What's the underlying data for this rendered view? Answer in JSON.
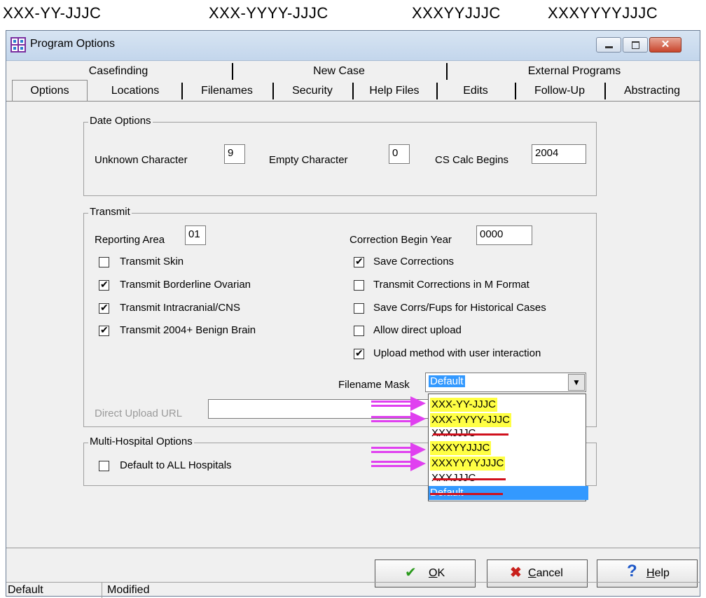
{
  "captions": [
    "XXX-YY-JJJC",
    "XXX-YYYY-JJJC",
    "XXXYYJJJC",
    "XXXYYYYJJJC"
  ],
  "window": {
    "title": "Program Options",
    "controls": [
      "minimize-icon",
      "maximize-icon",
      "close-icon"
    ]
  },
  "tabs": {
    "row1": [
      "Casefinding",
      "New Case",
      "External Programs"
    ],
    "row2": [
      "Options",
      "Locations",
      "Filenames",
      "Security",
      "Help Files",
      "Edits",
      "Follow-Up",
      "Abstracting"
    ],
    "active": "Options"
  },
  "date_options": {
    "title": "Date Options",
    "unknown_label": "Unknown Character",
    "unknown_value": "9",
    "empty_label": "Empty Character",
    "empty_value": "0",
    "cs_label": "CS Calc Begins",
    "cs_value": "2004"
  },
  "transmit": {
    "title": "Transmit",
    "reporting_label": "Reporting Area",
    "reporting_value": "01",
    "correction_label": "Correction Begin Year",
    "correction_value": "0000",
    "left_checks": [
      {
        "label": "Transmit Skin",
        "checked": false
      },
      {
        "label": "Transmit Borderline Ovarian",
        "checked": true
      },
      {
        "label": "Transmit Intracranial/CNS",
        "checked": true
      },
      {
        "label": "Transmit 2004+ Benign Brain",
        "checked": true
      }
    ],
    "right_checks": [
      {
        "label": "Save Corrections",
        "checked": true
      },
      {
        "label": "Transmit Corrections in M Format",
        "checked": false
      },
      {
        "label": "Save Corrs/Fups for Historical Cases",
        "checked": false
      },
      {
        "label": "Allow direct upload",
        "checked": false
      },
      {
        "label": "Upload method with user interaction",
        "checked": true
      }
    ],
    "filename_mask_label": "Filename Mask",
    "filename_mask_value": "Default",
    "direct_upload_label": "Direct Upload URL",
    "direct_upload_value": ""
  },
  "dropdown": {
    "options": [
      "XXX-YY-JJJC",
      "XXX-YYYY-JJJC",
      "XXXJJJC",
      "XXXYYJJJC",
      "XXXYYYYJJJC",
      "XXXJJJC",
      "Default"
    ],
    "highlighted": [
      0,
      1,
      3,
      4
    ],
    "struck": [
      2,
      5,
      6
    ],
    "selected": 6,
    "highlight_color": "#ffff44",
    "strike_color": "#d0101c",
    "arrow_color": "#e040f0"
  },
  "multi_hospital": {
    "title": "Multi-Hospital Options",
    "checkbox_label": "Default to ALL Hospitals",
    "checked": false
  },
  "buttons": {
    "ok_prefix": "O",
    "ok": "K",
    "cancel_prefix": "C",
    "cancel": "ancel",
    "help_prefix": "H",
    "help": "elp"
  },
  "status": {
    "left": "Default",
    "right": "Modified"
  }
}
